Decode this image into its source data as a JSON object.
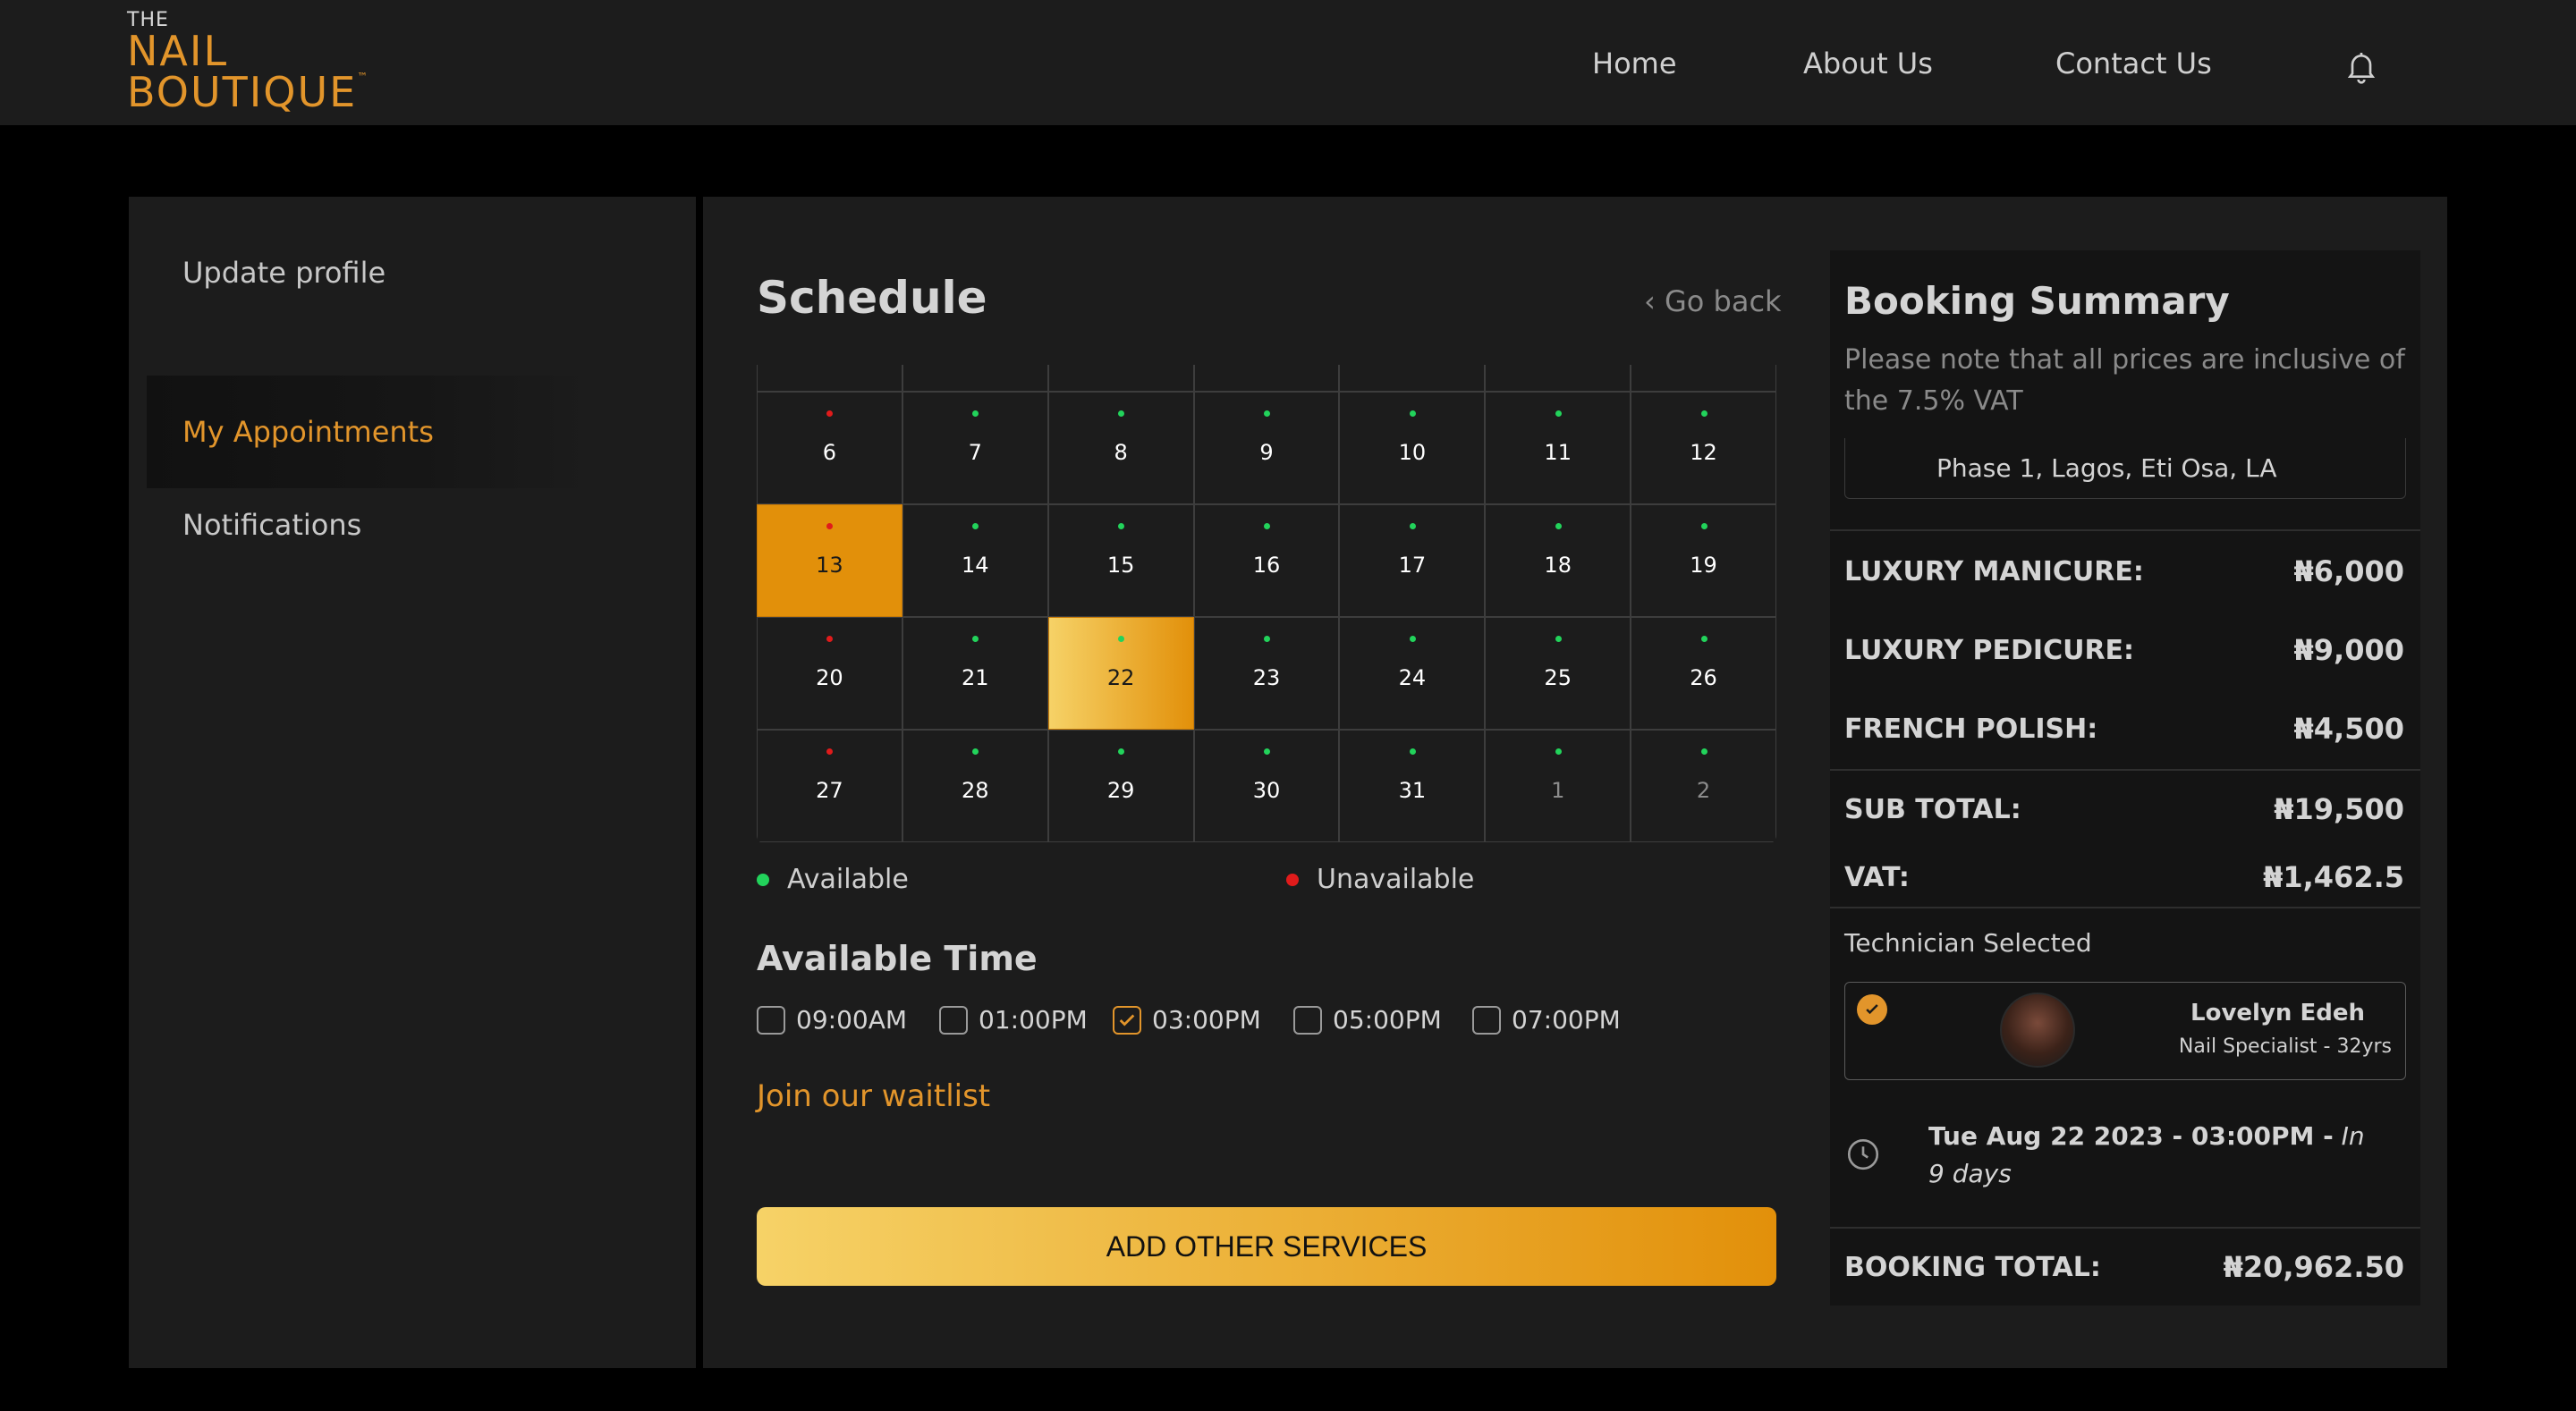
{
  "logo": {
    "the": "THE",
    "line1": "NAIL",
    "line2": "BOUTIQUE",
    "tm": "™"
  },
  "nav": {
    "home": "Home",
    "about": "About Us",
    "contact": "Contact Us"
  },
  "sidebar": {
    "items": [
      {
        "label": "Update profile",
        "active": false
      },
      {
        "label": "My Appointments",
        "active": true
      },
      {
        "label": "Notifications",
        "active": false
      }
    ]
  },
  "schedule": {
    "title": "Schedule",
    "go_back": "‹ Go back",
    "weeks": [
      [
        {
          "day": "6",
          "dot": "red"
        },
        {
          "day": "7",
          "dot": "green"
        },
        {
          "day": "8",
          "dot": "green"
        },
        {
          "day": "9",
          "dot": "green"
        },
        {
          "day": "10",
          "dot": "green"
        },
        {
          "day": "11",
          "dot": "green"
        },
        {
          "day": "12",
          "dot": "green"
        }
      ],
      [
        {
          "day": "13",
          "dot": "red",
          "state": "today"
        },
        {
          "day": "14",
          "dot": "green"
        },
        {
          "day": "15",
          "dot": "green"
        },
        {
          "day": "16",
          "dot": "green"
        },
        {
          "day": "17",
          "dot": "green"
        },
        {
          "day": "18",
          "dot": "green"
        },
        {
          "day": "19",
          "dot": "green"
        }
      ],
      [
        {
          "day": "20",
          "dot": "red"
        },
        {
          "day": "21",
          "dot": "green"
        },
        {
          "day": "22",
          "dot": "green",
          "state": "selected"
        },
        {
          "day": "23",
          "dot": "green"
        },
        {
          "day": "24",
          "dot": "green"
        },
        {
          "day": "25",
          "dot": "green"
        },
        {
          "day": "26",
          "dot": "green"
        }
      ],
      [
        {
          "day": "27",
          "dot": "red"
        },
        {
          "day": "28",
          "dot": "green"
        },
        {
          "day": "29",
          "dot": "green"
        },
        {
          "day": "30",
          "dot": "green"
        },
        {
          "day": "31",
          "dot": "green"
        },
        {
          "day": "1",
          "dot": "green",
          "muted": true
        },
        {
          "day": "2",
          "dot": "green",
          "muted": true
        }
      ]
    ],
    "legend": {
      "available": "Available",
      "unavailable": "Unavailable"
    },
    "available_time_title": "Available Time",
    "times": [
      {
        "label": "09:00AM",
        "checked": false
      },
      {
        "label": "01:00PM",
        "checked": false
      },
      {
        "label": "03:00PM",
        "checked": true
      },
      {
        "label": "05:00PM",
        "checked": false
      },
      {
        "label": "07:00PM",
        "checked": false
      }
    ],
    "waitlist": "Join our waitlist",
    "add_services": "ADD OTHER SERVICES"
  },
  "summary": {
    "title": "Booking Summary",
    "note": "Please note that all prices are inclusive of the 7.5% VAT",
    "address": "Phase 1, Lagos, Eti Osa, LA",
    "services": [
      {
        "label": "LUXURY MANICURE:",
        "value": "₦6,000"
      },
      {
        "label": "LUXURY PEDICURE:",
        "value": "₦9,000"
      },
      {
        "label": "FRENCH POLISH:",
        "value": "₦4,500"
      }
    ],
    "subtotal_label": "SUB TOTAL:",
    "subtotal_value": "₦19,500",
    "vat_label": "VAT:",
    "vat_value": "₦1,462.5",
    "technician_label": "Technician Selected",
    "technician_name": "Lovelyn Edeh",
    "technician_role": "Nail Specialist - 32yrs",
    "date_bold": "Tue Aug 22 2023 - 03:00PM -",
    "date_italic": "In 9 days",
    "total_label": "BOOKING TOTAL:",
    "total_value": "₦20,962.50"
  },
  "colors": {
    "accent": "#e2952b",
    "available": "#22d35b",
    "unavailable": "#e01b1b",
    "panel": "#1c1c1c"
  }
}
